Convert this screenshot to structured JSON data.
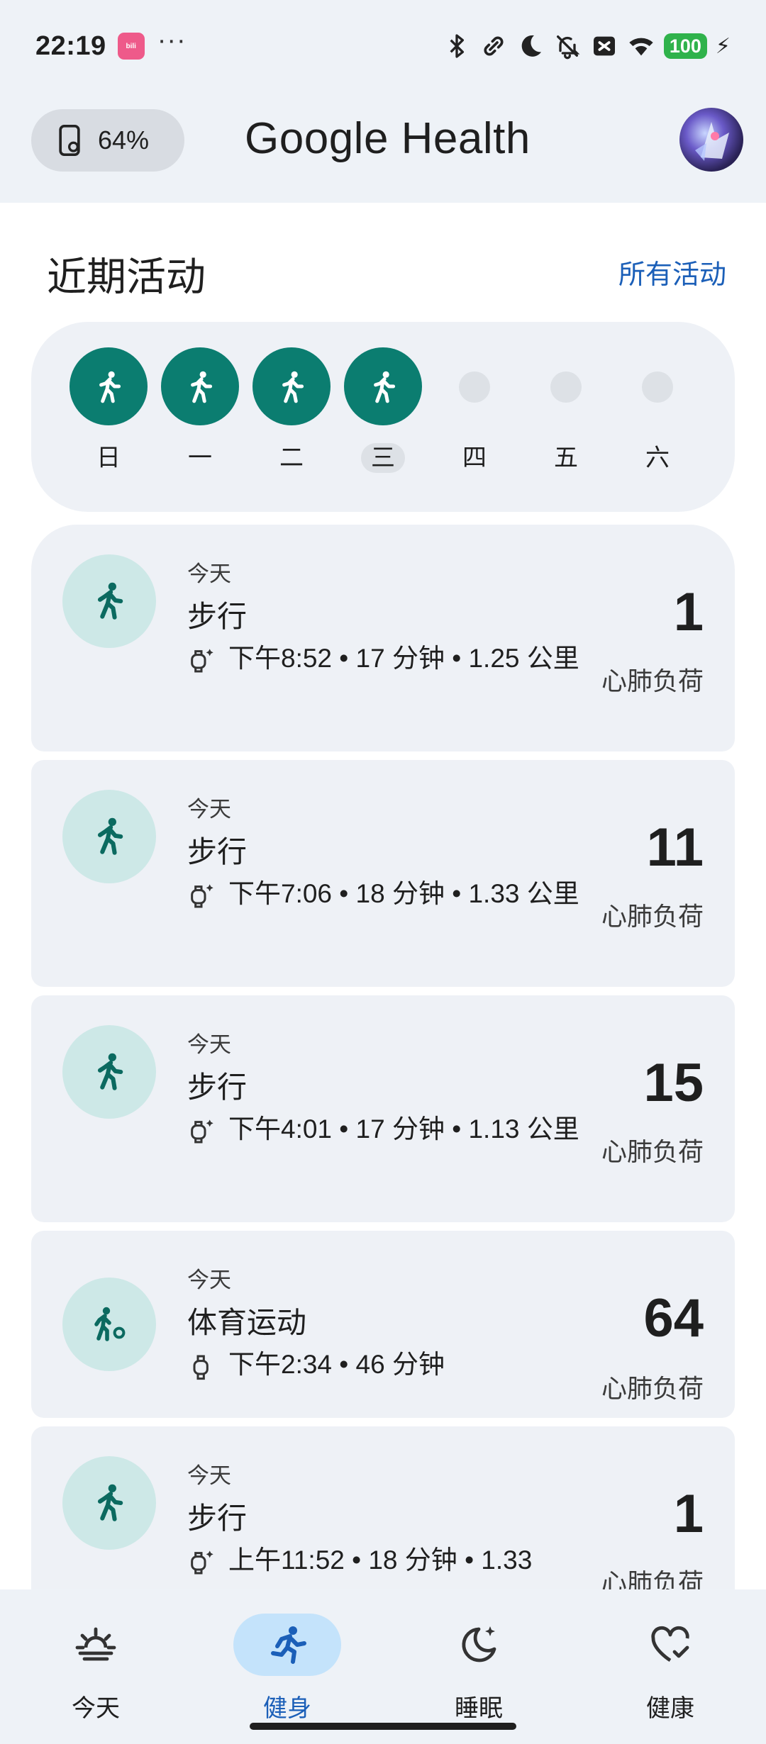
{
  "status_bar": {
    "time": "22:19",
    "app_icon": "bilibili",
    "more": "···",
    "battery": "100",
    "icons": [
      "bluetooth-icon",
      "link-icon",
      "moon-icon",
      "bell-off-icon",
      "signal-off-icon",
      "wifi-icon",
      "battery-icon",
      "charging-icon"
    ]
  },
  "header": {
    "watch_battery": "64%",
    "title": "Google Health"
  },
  "recent": {
    "title": "近期活动",
    "all_link": "所有活动"
  },
  "week": [
    {
      "label": "日",
      "done": true,
      "today": false
    },
    {
      "label": "一",
      "done": true,
      "today": false
    },
    {
      "label": "二",
      "done": true,
      "today": false
    },
    {
      "label": "三",
      "done": true,
      "today": true
    },
    {
      "label": "四",
      "done": false,
      "today": false
    },
    {
      "label": "五",
      "done": false,
      "today": false
    },
    {
      "label": "六",
      "done": false,
      "today": false
    }
  ],
  "activities": [
    {
      "when": "今天",
      "name": "步行",
      "meta": "下午8:52 • 17 分钟 • 1.25 公里",
      "score": "1",
      "unit": "心肺负荷",
      "icon": "walk-icon",
      "source": "watch-sparkle-icon"
    },
    {
      "when": "今天",
      "name": "步行",
      "meta": "下午7:06 • 18 分钟 • 1.33 公里",
      "score": "11",
      "unit": "心肺负荷",
      "icon": "walk-icon",
      "source": "watch-sparkle-icon"
    },
    {
      "when": "今天",
      "name": "步行",
      "meta": "下午4:01 • 17 分钟 • 1.13 公里",
      "score": "15",
      "unit": "心肺负荷",
      "icon": "walk-icon",
      "source": "watch-sparkle-icon"
    },
    {
      "when": "今天",
      "name": "体育运动",
      "meta": "下午2:34 • 46 分钟",
      "score": "64",
      "unit": "心肺负荷",
      "icon": "sports-icon",
      "source": "watch-icon"
    },
    {
      "when": "今天",
      "name": "步行",
      "meta": "上午11:52 • 18 分钟 • 1.33",
      "score": "1",
      "unit": "心肺负荷",
      "icon": "walk-icon",
      "source": "watch-sparkle-icon"
    }
  ],
  "nav": [
    {
      "label": "今天",
      "icon": "sunrise-icon",
      "active": false
    },
    {
      "label": "健身",
      "icon": "run-icon",
      "active": true
    },
    {
      "label": "睡眠",
      "icon": "moon-sparkle-icon",
      "active": false
    },
    {
      "label": "健康",
      "icon": "heart-check-icon",
      "active": false
    }
  ],
  "colors": {
    "accent": "#0b7d70",
    "link": "#1b5fb8",
    "card": "#eef1f6",
    "nav_active": "#c4e3fb"
  }
}
